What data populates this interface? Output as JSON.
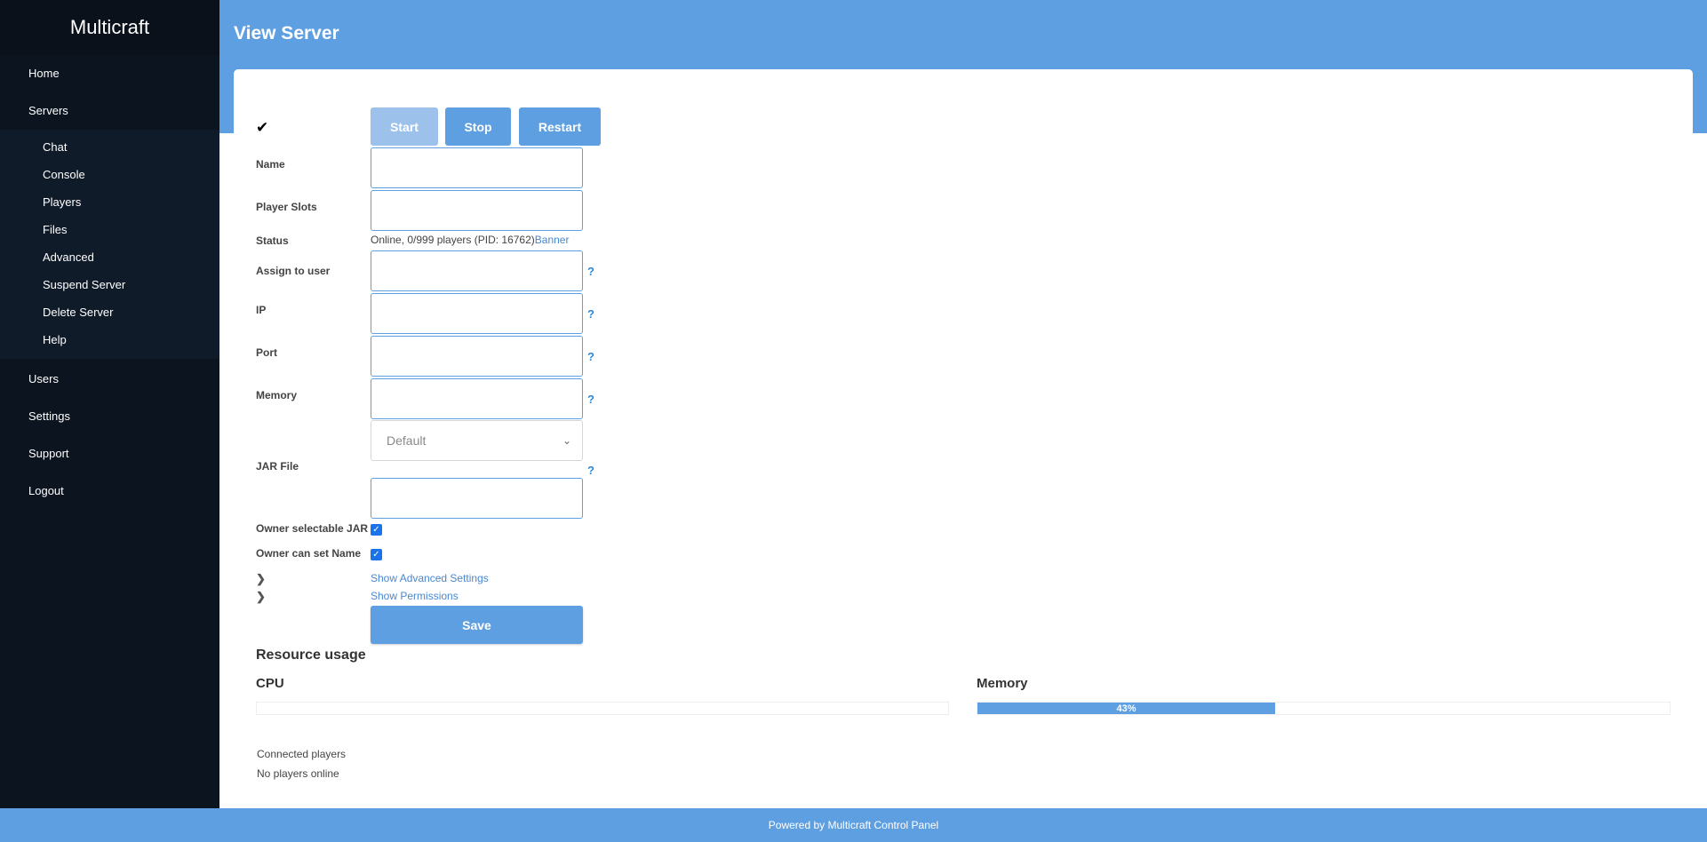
{
  "app": {
    "brand": "Multicraft"
  },
  "sidebar": {
    "items_top": [
      {
        "label": "Home"
      },
      {
        "label": "Servers"
      }
    ],
    "submenu": [
      {
        "label": "Chat"
      },
      {
        "label": "Console"
      },
      {
        "label": "Players"
      },
      {
        "label": "Files"
      },
      {
        "label": "Advanced"
      },
      {
        "label": "Suspend Server"
      },
      {
        "label": "Delete Server"
      },
      {
        "label": "Help"
      }
    ],
    "items_bottom": [
      {
        "label": "Users"
      },
      {
        "label": "Settings"
      },
      {
        "label": "Support"
      },
      {
        "label": "Logout"
      }
    ]
  },
  "header": {
    "title": "View Server"
  },
  "controls": {
    "start": "Start",
    "stop": "Stop",
    "restart": "Restart"
  },
  "form": {
    "name_label": "Name",
    "slots_label": "Player Slots",
    "status_label": "Status",
    "status_value": "Online, 0/999 players (PID: 16762)",
    "status_link": "Banner",
    "assign_label": "Assign to user",
    "ip_label": "IP",
    "port_label": "Port",
    "memory_label": "Memory",
    "jar_select_value": "Default",
    "jar_label": "JAR File",
    "owner_jar_label": "Owner selectable JAR",
    "owner_name_label": "Owner can set Name",
    "help_mark": "?",
    "show_advanced": "Show Advanced Settings",
    "show_permissions": "Show Permissions",
    "save": "Save"
  },
  "resources": {
    "title": "Resource usage",
    "cpu_label": "CPU",
    "memory_label": "Memory",
    "memory_percent_text": "43%",
    "memory_fraction": 0.43,
    "connected_label": "Connected players",
    "players_status": "No players online"
  },
  "footer": {
    "text": "Powered by Multicraft Control Panel"
  },
  "colors": {
    "accent": "#5e9fe1",
    "sidebar": "#0c1420"
  }
}
